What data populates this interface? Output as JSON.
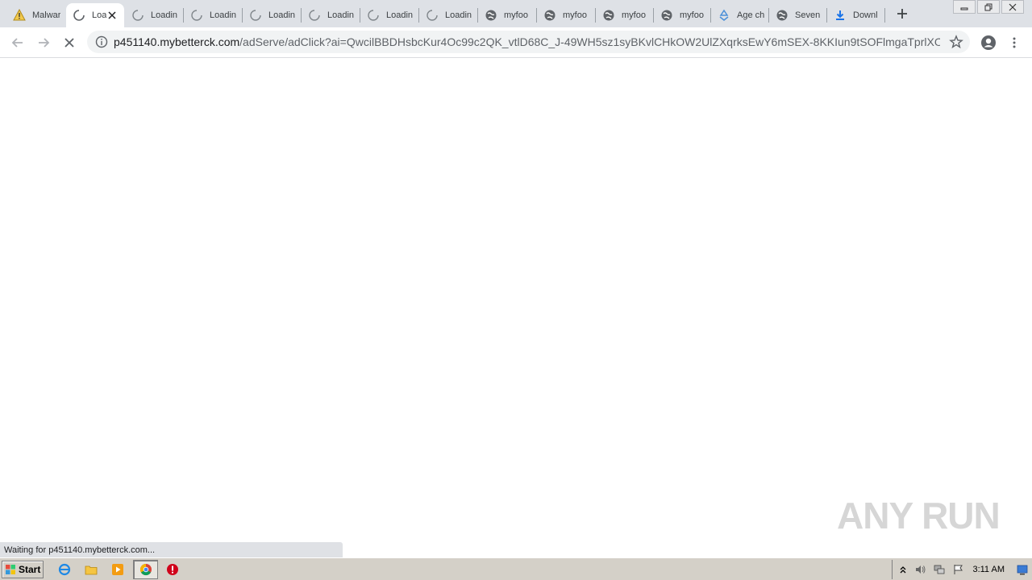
{
  "browser": {
    "tabs": [
      {
        "title": "Malwar",
        "icon": "warning-icon",
        "active": false
      },
      {
        "title": "Loa",
        "icon": "loading-spinner-icon",
        "active": true
      },
      {
        "title": "Loadin",
        "icon": "loading-spinner-icon",
        "active": false
      },
      {
        "title": "Loadin",
        "icon": "loading-spinner-icon",
        "active": false
      },
      {
        "title": "Loadin",
        "icon": "loading-spinner-icon",
        "active": false
      },
      {
        "title": "Loadin",
        "icon": "loading-spinner-icon",
        "active": false
      },
      {
        "title": "Loadin",
        "icon": "loading-spinner-icon",
        "active": false
      },
      {
        "title": "Loadin",
        "icon": "loading-spinner-icon",
        "active": false
      },
      {
        "title": "myfoo",
        "icon": "globe-icon",
        "active": false
      },
      {
        "title": "myfoo",
        "icon": "globe-icon",
        "active": false
      },
      {
        "title": "myfoo",
        "icon": "globe-icon",
        "active": false
      },
      {
        "title": "myfoo",
        "icon": "globe-icon",
        "active": false
      },
      {
        "title": "Age ch",
        "icon": "recycle-icon",
        "active": false
      },
      {
        "title": "Seven",
        "icon": "globe-icon",
        "active": false
      },
      {
        "title": "Downl",
        "icon": "download-icon",
        "active": false
      }
    ],
    "url_host": "p451140.mybetterck.com",
    "url_rest": "/adServe/adClick?ai=QwcilBBDHsbcKur4Oc99c2QK_vtlD68C_J-49WH5sz1syBKvlCHkOW2UlZXqrksEwY6mSEX-8KKIun9tSOFlmgaTprlXOMa...",
    "status_text": "Waiting for p451140.mybetterck.com..."
  },
  "watermark": "ANY RUN",
  "taskbar": {
    "start_label": "Start",
    "clock": "3:11 AM",
    "quicklaunch": [
      "ie-icon",
      "folder-icon",
      "media-player-icon",
      "chrome-icon",
      "stop-icon"
    ]
  },
  "colors": {
    "tabstrip": "#dee1e6",
    "omnibox": "#f1f3f4",
    "taskbar": "#d4d0c8",
    "watermark": "#d6d6d6"
  }
}
